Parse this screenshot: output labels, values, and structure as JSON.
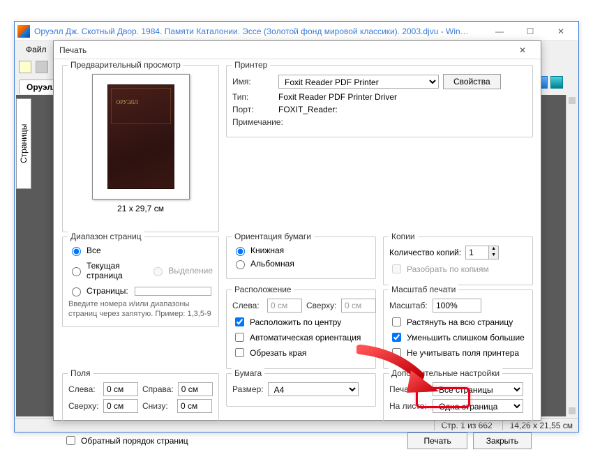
{
  "window": {
    "title": "Оруэлл Дж. Скотный Двор. 1984. Памяти Каталонии. Эссе (Золотой фонд мировой классики). 2003.djvu - Win…"
  },
  "menu": {
    "file": "Файл"
  },
  "tab": {
    "active": "Оруэлл"
  },
  "sidebar": {
    "pages_tab": "Страницы"
  },
  "statusbar": {
    "page": "Стр. 1 из 662",
    "dims": "14,26 x 21,55 см"
  },
  "dialog": {
    "title": "Печать",
    "preview": {
      "title": "Предварительный просмотр",
      "dims": "21 x 29,7 см",
      "book_label": "ОРУЭЛЛ"
    },
    "printer": {
      "title": "Принтер",
      "name_label": "Имя:",
      "name_value": "Foxit Reader PDF Printer",
      "props_btn": "Свойства",
      "type_label": "Тип:",
      "type_value": "Foxit Reader PDF Printer Driver",
      "port_label": "Порт:",
      "port_value": "FOXIT_Reader:",
      "note_label": "Примечание:"
    },
    "orientation": {
      "title": "Ориентация бумаги",
      "portrait": "Книжная",
      "landscape": "Альбомная"
    },
    "copies": {
      "title": "Копии",
      "label": "Количество копий:",
      "value": "1",
      "collate": "Разобрать по копиям"
    },
    "range": {
      "title": "Диапазон страниц",
      "all": "Все",
      "current": "Текущая страница",
      "selection": "Выделение",
      "pages": "Страницы:",
      "hint": "Введите номера и/или диапазоны страниц через запятую. Пример: 1,3,5-9"
    },
    "layout": {
      "title": "Расположение",
      "left_label": "Слева:",
      "top_label": "Сверху:",
      "zero": "0 см",
      "center": "Расположить по центру",
      "autoorient": "Автоматическая ориентация",
      "crop": "Обрезать края"
    },
    "scale": {
      "title": "Масштаб печати",
      "label": "Масштаб:",
      "value": "100%",
      "fit": "Растянуть на всю страницу",
      "shrink": "Уменьшить слишком большие",
      "ignore_margins": "Не учитывать поля принтера"
    },
    "margins": {
      "title": "Поля",
      "left": "Слева:",
      "right": "Справа:",
      "top": "Сверху:",
      "bottom": "Снизу:",
      "zero": "0 см"
    },
    "paper": {
      "title": "Бумага",
      "size_label": "Размер:",
      "size_value": "A4"
    },
    "extra": {
      "title": "Дополнительные настройки",
      "print_label": "Печатать:",
      "print_value": "Все страницы",
      "sheet_label": "На листе:",
      "sheet_value": "Одна страница"
    },
    "reverse": "Обратный порядок страниц",
    "print_btn": "Печать",
    "close_btn": "Закрыть"
  }
}
